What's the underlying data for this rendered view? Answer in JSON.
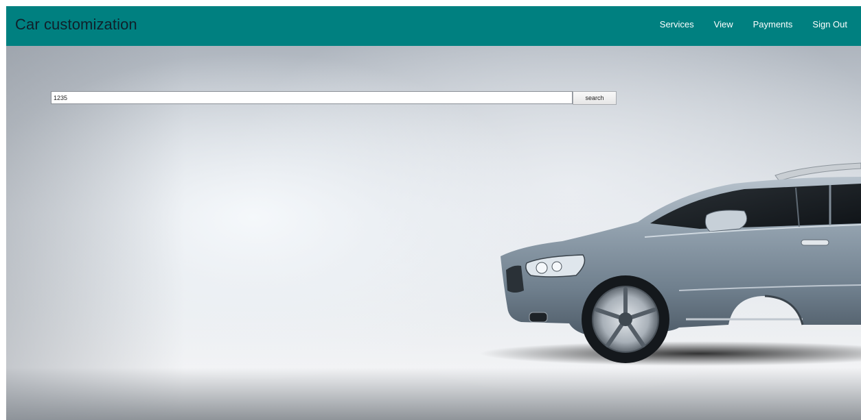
{
  "header": {
    "title": "Car customization",
    "nav": [
      {
        "label": "Services"
      },
      {
        "label": "View"
      },
      {
        "label": "Payments"
      },
      {
        "label": "Sign Out"
      }
    ]
  },
  "search": {
    "value": "1235",
    "button_label": "search"
  },
  "colors": {
    "navbar": "#008080",
    "nav_text": "#ffffff",
    "brand_text": "#10202a"
  },
  "icons": {
    "hero_image": "car-illustration"
  }
}
